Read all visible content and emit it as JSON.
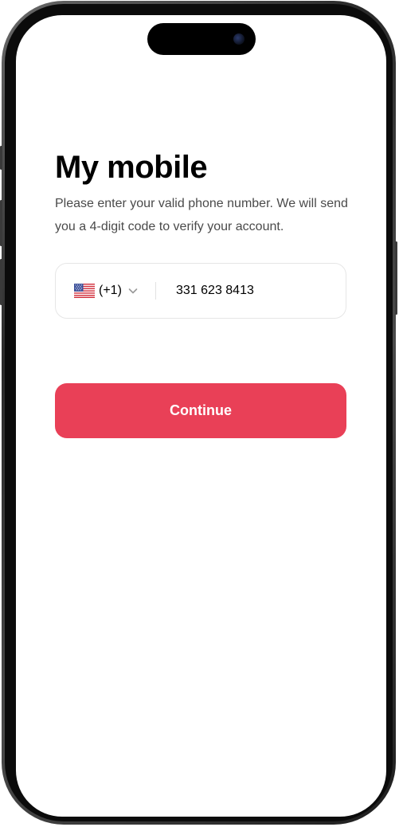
{
  "screen": {
    "title": "My mobile",
    "subtitle": "Please enter your valid phone number. We will send you a 4-digit code to verify your account."
  },
  "phone_field": {
    "country_flag": "us-flag-icon",
    "dial_code": "(+1)",
    "dropdown_icon": "chevron-down-icon",
    "number": "331 623 8413"
  },
  "actions": {
    "continue_label": "Continue"
  },
  "colors": {
    "accent": "#e94057",
    "text_primary": "#000000",
    "text_secondary": "#4a4a4a",
    "field_border": "#e6e6e6"
  }
}
